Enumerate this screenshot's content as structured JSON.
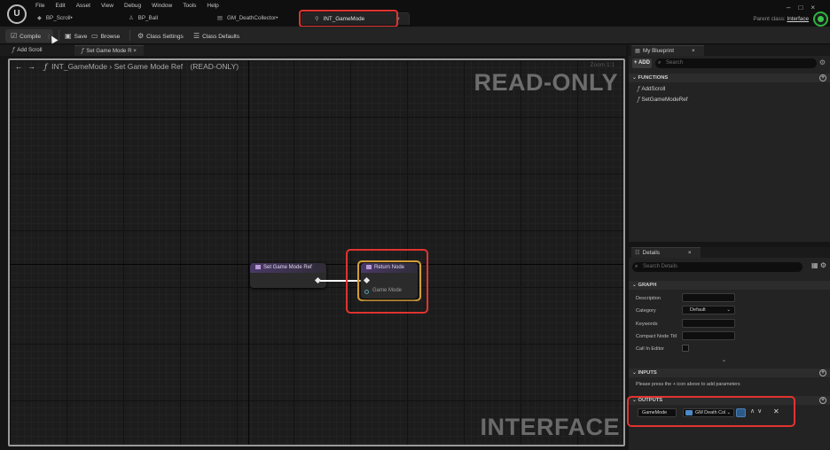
{
  "app": {
    "logo": "U"
  },
  "menu": [
    "File",
    "Edit",
    "Asset",
    "View",
    "Debug",
    "Window",
    "Tools",
    "Help"
  ],
  "doc_tabs": [
    {
      "label": "BP_Scroll•",
      "icon": "blueprint-icon"
    },
    {
      "label": "BP_Ball",
      "icon": "actor-icon"
    },
    {
      "label": "GM_DeathCollector•",
      "icon": "blueprint-icon"
    },
    {
      "label": "INT_GameMode",
      "icon": "interface-icon",
      "active": true,
      "close": "×"
    }
  ],
  "parent_class": {
    "label": "Parent class:",
    "value": "Interface"
  },
  "window_controls": [
    "–",
    "□",
    "×"
  ],
  "toolbar": {
    "compile": "Compile",
    "save": "Save",
    "browse": "Browse",
    "class_settings": "Class Settings",
    "class_defaults": "Class Defaults"
  },
  "graph_tabs": [
    {
      "label": "Add Scroll",
      "icon": "function-icon"
    },
    {
      "label": "Set Game Mode R ×",
      "icon": "function-icon",
      "active": true
    }
  ],
  "graph": {
    "breadcrumb_root": "INT_GameMode",
    "breadcrumb_sep": "›",
    "breadcrumb_leaf": "Set Game Mode Ref",
    "mode": "(READ-ONLY)",
    "zoom": "Zoom 1:1",
    "watermark_top": "READ-ONLY",
    "watermark_bottom": "INTERFACE",
    "node_entry": "Set Game Mode Ref",
    "node_return": "Return Node",
    "return_pin": "Game Mode"
  },
  "my_blueprint": {
    "tab": "My Blueprint",
    "close": "×",
    "add": "+ ADD",
    "search_placeholder": "Search",
    "functions_header": "FUNCTIONS",
    "functions": [
      "AddScroll",
      "SetGameModeRef"
    ]
  },
  "details": {
    "tab": "Details",
    "close": "×",
    "search_placeholder": "Search Details",
    "graph_header": "GRAPH",
    "fields": {
      "description": "Description",
      "category": "Category",
      "category_value": "Default",
      "keywords": "Keywords",
      "compact_node_title": "Compact Node Titl",
      "call_in_editor": "Call In Editor"
    },
    "inputs_header": "INPUTS",
    "inputs_hint": "Please press the + icon above to add parameters",
    "outputs_header": "OUTPUTS",
    "output_name": "GameMode",
    "output_type": "GM Death Col"
  },
  "colors": {
    "highlight": "#e0342f",
    "selection": "#d9a23a",
    "node_header": "#4a3966",
    "status_green": "#3cc24c"
  }
}
